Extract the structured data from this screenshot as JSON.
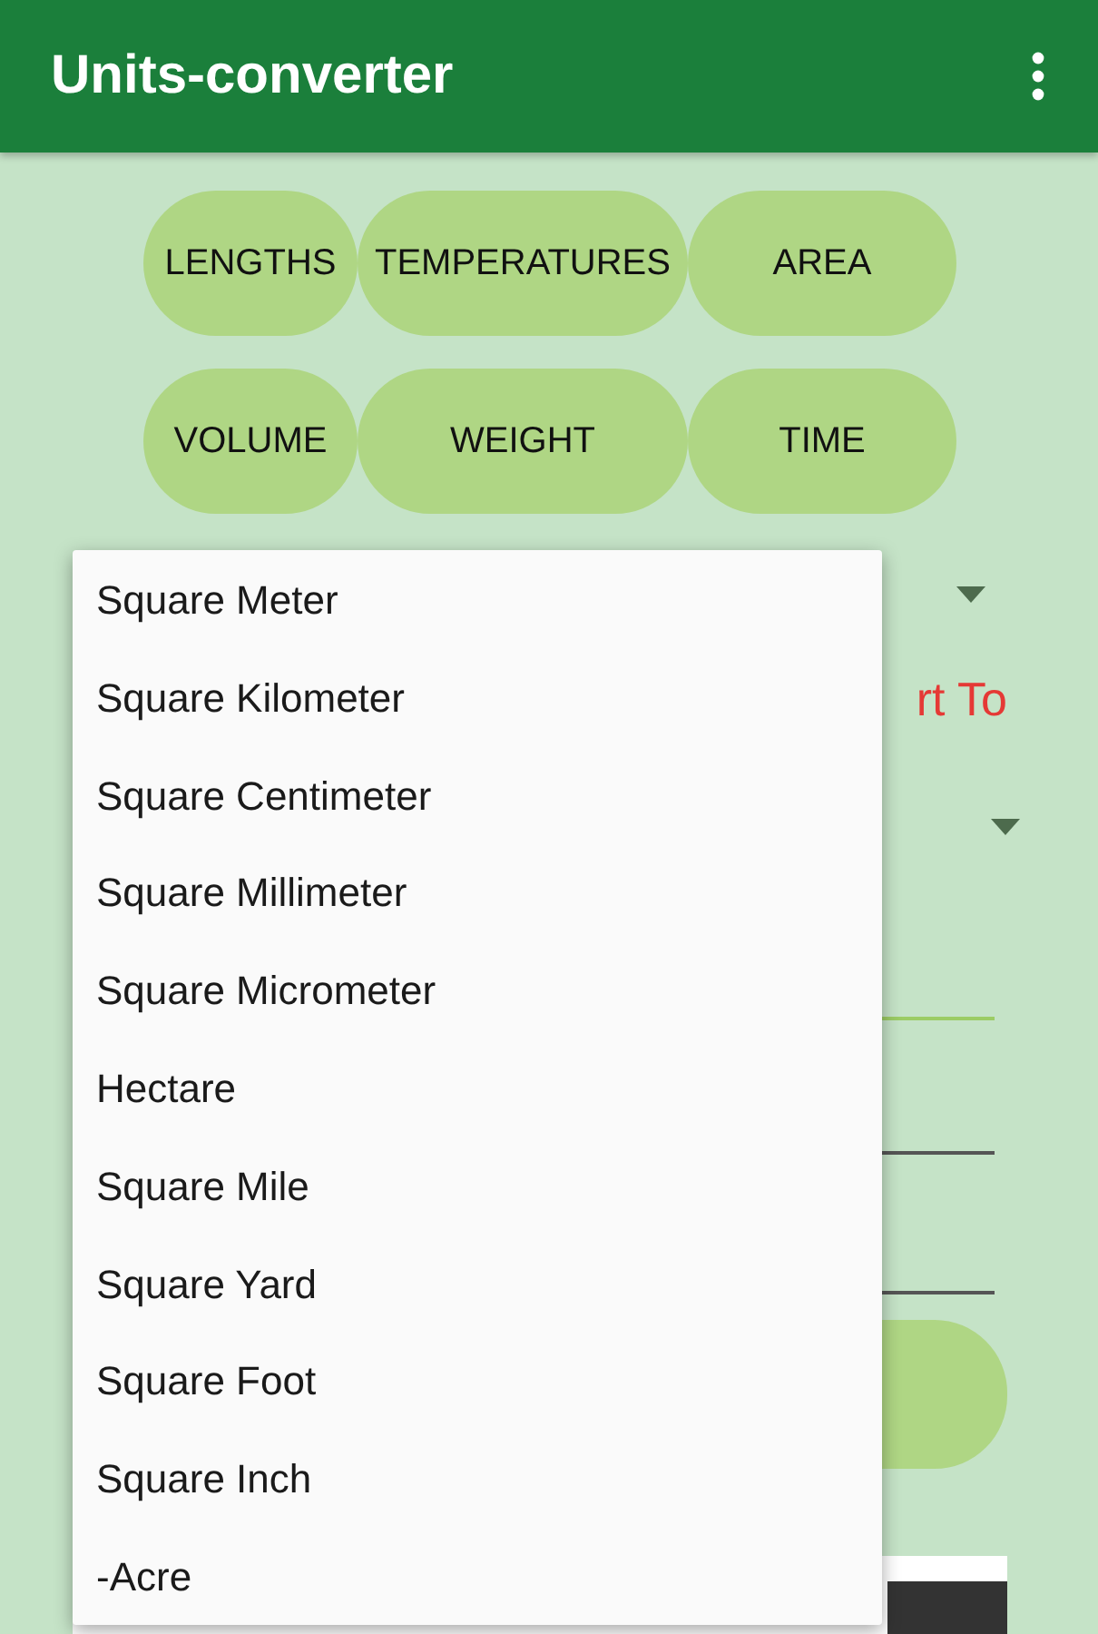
{
  "app_bar": {
    "title": "Units-converter"
  },
  "categories": [
    {
      "label": "LENGTHS"
    },
    {
      "label": "TEMPERATURES"
    },
    {
      "label": "AREA"
    },
    {
      "label": "VOLUME"
    },
    {
      "label": "WEIGHT"
    },
    {
      "label": "TIME"
    }
  ],
  "form": {
    "convert_to_label": "rt To"
  },
  "dropdown": {
    "items": [
      "Square Meter",
      "Square Kilometer",
      "Square Centimeter",
      "Square Millimeter",
      "Square Micrometer",
      "Hectare",
      "Square Mile",
      "Square Yard",
      "Square Foot",
      "Square Inch",
      "-Acre"
    ]
  }
}
